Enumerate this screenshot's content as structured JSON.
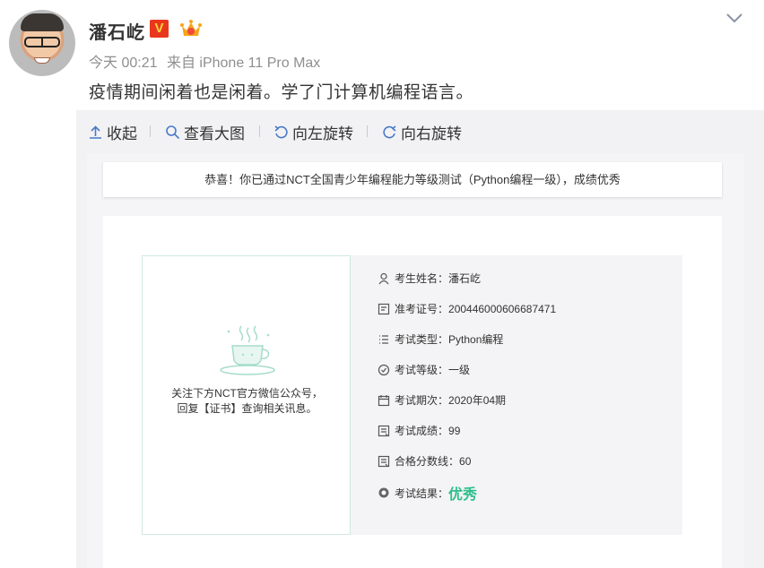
{
  "post": {
    "username": "潘石屹",
    "verified_badge": "V",
    "timestamp": "今天 00:21",
    "source": "来自 iPhone 11 Pro Max",
    "text": "疫情期间闲着也是闲着。学了门计算机编程语言。"
  },
  "media_toolbar": {
    "collapse": "收起",
    "view_large": "查看大图",
    "rotate_left": "向左旋转",
    "rotate_right": "向右旋转"
  },
  "certificate": {
    "congrats": "恭喜！你已通过NCT全国青少年编程能力等级测试（Python编程一级），成绩优秀",
    "qr_text_line1": "关注下方NCT官方微信公众号，",
    "qr_text_line2": "回复【证书】查询相关讯息。",
    "fields": [
      {
        "label": "考生姓名：",
        "value": "潘石屹",
        "icon": "person-icon"
      },
      {
        "label": "准考证号：",
        "value": "200446000606687471",
        "icon": "id-card-icon"
      },
      {
        "label": "考试类型：",
        "value": "Python编程",
        "icon": "list-icon"
      },
      {
        "label": "考试等级：",
        "value": "一级",
        "icon": "level-icon"
      },
      {
        "label": "考试期次：",
        "value": "2020年04期",
        "icon": "calendar-icon"
      },
      {
        "label": "考试成绩：",
        "value": "99",
        "icon": "score-icon"
      },
      {
        "label": "合格分数线：",
        "value": "60",
        "icon": "score-icon"
      }
    ],
    "result": {
      "label": "考试结果：",
      "value": "优秀",
      "icon": "result-icon"
    }
  },
  "colors": {
    "result_green": "#2dc08b",
    "badge_red": "#e8371c",
    "toolbar_icon_blue": "#4a78c8"
  }
}
